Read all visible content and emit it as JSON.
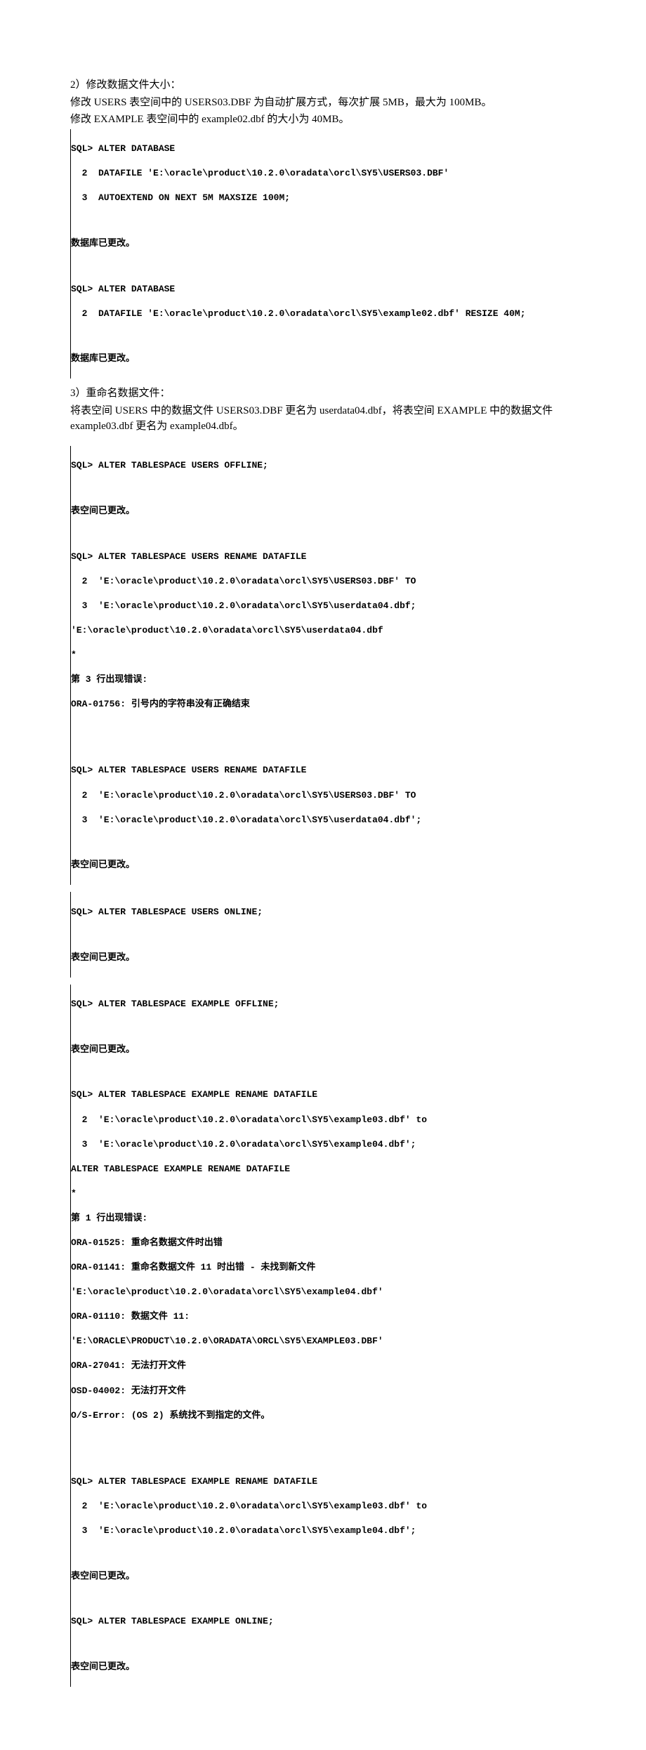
{
  "section2": {
    "title": "2）修改数据文件大小：",
    "desc1": "修改 USERS 表空间中的 USERS03.DBF 为自动扩展方式，每次扩展 5MB，最大为 100MB。",
    "desc2": "修改 EXAMPLE 表空间中的 example02.dbf 的大小为 40MB。",
    "term1_line1": "SQL> ALTER DATABASE",
    "term1_line2": "  2  DATAFILE 'E:\\oracle\\product\\10.2.0\\oradata\\orcl\\SY5\\USERS03.DBF'",
    "term1_line3": "  3  AUTOEXTEND ON NEXT 5M MAXSIZE 100M;",
    "term1_result": "数据库已更改。",
    "term2_line1": "SQL> ALTER DATABASE",
    "term2_line2": "  2  DATAFILE 'E:\\oracle\\product\\10.2.0\\oradata\\orcl\\SY5\\example02.dbf' RESIZE 40M;",
    "term2_result": "数据库已更改。"
  },
  "section3": {
    "title": "3）重命名数据文件：",
    "desc1": "将表空间 USERS 中的数据文件 USERS03.DBF 更名为 userdata04.dbf，将表空间 EXAMPLE 中的数据文件example03.dbf 更名为 example04.dbf。",
    "term1_line1": "SQL> ALTER TABLESPACE USERS OFFLINE;",
    "term1_result": "表空间已更改。",
    "term2_line1": "SQL> ALTER TABLESPACE USERS RENAME DATAFILE",
    "term2_line2": "  2  'E:\\oracle\\product\\10.2.0\\oradata\\orcl\\SY5\\USERS03.DBF' TO",
    "term2_line3": "  3  'E:\\oracle\\product\\10.2.0\\oradata\\orcl\\SY5\\userdata04.dbf;",
    "term2_line4": "'E:\\oracle\\product\\10.2.0\\oradata\\orcl\\SY5\\userdata04.dbf",
    "term2_line5": "*",
    "term2_err1": "第 3 行出现错误:",
    "term2_err2": "ORA-01756: 引号内的字符串没有正确结束",
    "term3_line1": "SQL> ALTER TABLESPACE USERS RENAME DATAFILE",
    "term3_line2": "  2  'E:\\oracle\\product\\10.2.0\\oradata\\orcl\\SY5\\USERS03.DBF' TO",
    "term3_line3": "  3  'E:\\oracle\\product\\10.2.0\\oradata\\orcl\\SY5\\userdata04.dbf';",
    "term3_result": "表空间已更改。",
    "term4_line1": "SQL> ALTER TABLESPACE USERS ONLINE;",
    "term4_result": "表空间已更改。",
    "term5_line1": "SQL> ALTER TABLESPACE EXAMPLE OFFLINE;",
    "term5_result": "表空间已更改。",
    "term6_line1": "SQL> ALTER TABLESPACE EXAMPLE RENAME DATAFILE",
    "term6_line2": "  2  'E:\\oracle\\product\\10.2.0\\oradata\\orcl\\SY5\\example03.dbf' to",
    "term6_line3": "  3  'E:\\oracle\\product\\10.2.0\\oradata\\orcl\\SY5\\example04.dbf';",
    "term6_line4": "ALTER TABLESPACE EXAMPLE RENAME DATAFILE",
    "term6_line5": "*",
    "term6_err1": "第 1 行出现错误:",
    "term6_err2": "ORA-01525: 重命名数据文件时出错",
    "term6_err3": "ORA-01141: 重命名数据文件 11 时出错 - 未找到新文件",
    "term6_err4": "'E:\\oracle\\product\\10.2.0\\oradata\\orcl\\SY5\\example04.dbf'",
    "term6_err5": "ORA-01110: 数据文件 11:",
    "term6_err6": "'E:\\ORACLE\\PRODUCT\\10.2.0\\ORADATA\\ORCL\\SY5\\EXAMPLE03.DBF'",
    "term6_err7": "ORA-27041: 无法打开文件",
    "term6_err8": "OSD-04002: 无法打开文件",
    "term6_err9": "O/S-Error: (OS 2) 系统找不到指定的文件。",
    "term7_line1": "SQL> ALTER TABLESPACE EXAMPLE RENAME DATAFILE",
    "term7_line2": "  2  'E:\\oracle\\product\\10.2.0\\oradata\\orcl\\SY5\\example03.dbf' to",
    "term7_line3": "  3  'E:\\oracle\\product\\10.2.0\\oradata\\orcl\\SY5\\example04.dbf';",
    "term7_result": "表空间已更改。",
    "term8_line1": "SQL> ALTER TABLESPACE EXAMPLE ONLINE;",
    "term8_result": "表空间已更改。"
  }
}
